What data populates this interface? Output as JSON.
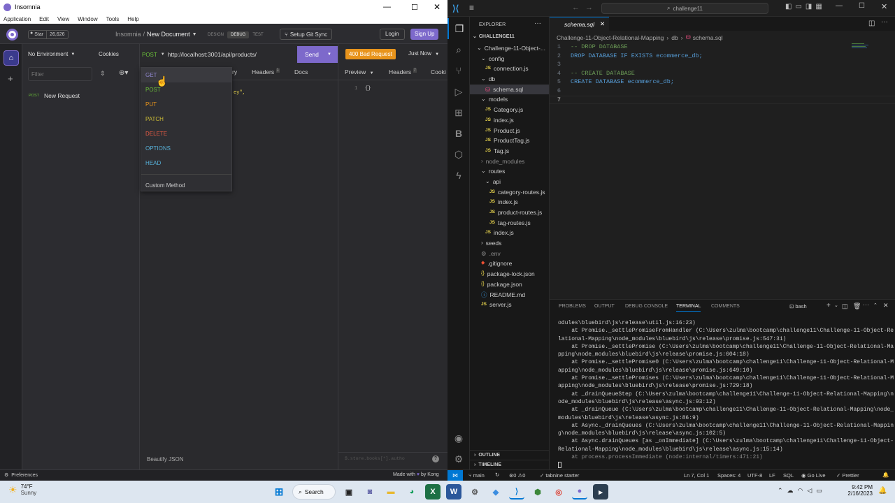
{
  "insomnia": {
    "window_title": "Insomnia",
    "menu": [
      "Application",
      "Edit",
      "View",
      "Window",
      "Tools",
      "Help"
    ],
    "github": {
      "star": "Star",
      "count": "26,626"
    },
    "breadcrumb": {
      "root": "Insomnia",
      "sep": "/",
      "doc": "New Document"
    },
    "modes": [
      "DESIGN",
      "DEBUG",
      "TEST"
    ],
    "git_sync": "Setup Git Sync",
    "login": "Login",
    "signup": "Sign Up",
    "environment": "No Environment",
    "cookies": "Cookies",
    "filter_placeholder": "Filter",
    "sidebar_request": {
      "method": "POST",
      "name": "New Request"
    },
    "url_bar": {
      "method": "POST",
      "url": "http://localhost:3001/api/products/",
      "send": "Send"
    },
    "status": {
      "badge": "400 Bad Request",
      "time": "Just Now"
    },
    "req_tabs": {
      "hidden": "ry",
      "headers": "Headers",
      "headers_count": "1",
      "docs": "Docs"
    },
    "resp_tabs": {
      "preview": "Preview",
      "headers": "Headers",
      "headers_count": "7",
      "cookies": "Cooki"
    },
    "body_fragment": "ey\",",
    "response": {
      "line": "1",
      "body": "{}"
    },
    "method_menu": [
      "GET",
      "POST",
      "PUT",
      "PATCH",
      "DELETE",
      "OPTIONS",
      "HEAD"
    ],
    "custom_method": "Custom Method",
    "beautify": "Beautify JSON",
    "filter_response": "$.store.books[*].autho",
    "footer": {
      "preferences": "Preferences",
      "made_with": "Made with",
      "by": "by Kong"
    }
  },
  "vscode": {
    "search": "challenge11",
    "explorer_title": "EXPLORER",
    "project": "CHALLENGE11",
    "tree": [
      {
        "label": "Challenge-11-Object-...",
        "kind": "folder",
        "depth": 1,
        "open": true
      },
      {
        "label": "config",
        "kind": "folder",
        "depth": 2,
        "open": true
      },
      {
        "label": "connection.js",
        "kind": "js",
        "depth": 3
      },
      {
        "label": "db",
        "kind": "folder",
        "depth": 2,
        "open": true
      },
      {
        "label": "schema.sql",
        "kind": "sql",
        "depth": 3,
        "selected": true
      },
      {
        "label": "models",
        "kind": "folder",
        "depth": 2,
        "open": true
      },
      {
        "label": "Category.js",
        "kind": "js",
        "depth": 3
      },
      {
        "label": "index.js",
        "kind": "js",
        "depth": 3
      },
      {
        "label": "Product.js",
        "kind": "js",
        "depth": 3
      },
      {
        "label": "ProductTag.js",
        "kind": "js",
        "depth": 3
      },
      {
        "label": "Tag.js",
        "kind": "js",
        "depth": 3
      },
      {
        "label": "node_modules",
        "kind": "folder",
        "depth": 2,
        "open": false,
        "dim": true
      },
      {
        "label": "routes",
        "kind": "folder",
        "depth": 2,
        "open": true
      },
      {
        "label": "api",
        "kind": "folder",
        "depth": 3,
        "open": true
      },
      {
        "label": "category-routes.js",
        "kind": "js",
        "depth": 4
      },
      {
        "label": "index.js",
        "kind": "js",
        "depth": 4
      },
      {
        "label": "product-routes.js",
        "kind": "js",
        "depth": 4
      },
      {
        "label": "tag-routes.js",
        "kind": "js",
        "depth": 4
      },
      {
        "label": "index.js",
        "kind": "js",
        "depth": 3
      },
      {
        "label": "seeds",
        "kind": "folder",
        "depth": 2,
        "open": false
      },
      {
        "label": ".env",
        "kind": "env",
        "depth": 2,
        "dim": true
      },
      {
        "label": ".gitignore",
        "kind": "git",
        "depth": 2
      },
      {
        "label": "package-lock.json",
        "kind": "json",
        "depth": 2
      },
      {
        "label": "package.json",
        "kind": "json",
        "depth": 2
      },
      {
        "label": "README.md",
        "kind": "md",
        "depth": 2
      },
      {
        "label": "server.js",
        "kind": "js",
        "depth": 2
      }
    ],
    "outline": "OUTLINE",
    "timeline": "TIMELINE",
    "tab": "schema.sql",
    "breadcrumbs": [
      "Challenge-11-Object-Relational-Mapping",
      "db",
      "schema.sql"
    ],
    "code": [
      {
        "n": "1",
        "text": "-- DROP DATABASE",
        "cls": "comment"
      },
      {
        "n": "2",
        "text": "DROP DATABASE IF EXISTS ecommerce_db;",
        "cls": "sql"
      },
      {
        "n": "3",
        "text": "",
        "cls": ""
      },
      {
        "n": "4",
        "text": "-- CREATE DATABASE",
        "cls": "comment"
      },
      {
        "n": "5",
        "text": "CREATE DATABASE ecommerce_db;",
        "cls": "sql"
      },
      {
        "n": "6",
        "text": "",
        "cls": ""
      },
      {
        "n": "7",
        "text": "",
        "cls": ""
      }
    ],
    "panel_tabs": [
      "PROBLEMS",
      "OUTPUT",
      "DEBUG CONSOLE",
      "TERMINAL",
      "COMMENTS"
    ],
    "shell": "bash",
    "terminal": [
      "odules\\bluebird\\js\\release\\util.js:16:23)",
      "    at Promise._settlePromiseFromHandler (C:\\Users\\zulma\\bootcamp\\challenge11\\Challenge-11-Object-Re",
      "lational-Mapping\\node_modules\\bluebird\\js\\release\\promise.js:547:31)",
      "    at Promise._settlePromise (C:\\Users\\zulma\\bootcamp\\challenge11\\Challenge-11-Object-Relational-Ma",
      "pping\\node_modules\\bluebird\\js\\release\\promise.js:604:18)",
      "    at Promise._settlePromise0 (C:\\Users\\zulma\\bootcamp\\challenge11\\Challenge-11-Object-Relational-M",
      "apping\\node_modules\\bluebird\\js\\release\\promise.js:649:10)",
      "    at Promise._settlePromises (C:\\Users\\zulma\\bootcamp\\challenge11\\Challenge-11-Object-Relational-M",
      "apping\\node_modules\\bluebird\\js\\release\\promise.js:729:18)",
      "    at _drainQueueStep (C:\\Users\\zulma\\bootcamp\\challenge11\\Challenge-11-Object-Relational-Mapping\\n",
      "ode_modules\\bluebird\\js\\release\\async.js:93:12)",
      "    at _drainQueue (C:\\Users\\zulma\\bootcamp\\challenge11\\Challenge-11-Object-Relational-Mapping\\node_",
      "modules\\bluebird\\js\\release\\async.js:86:9)",
      "    at Async._drainQueues (C:\\Users\\zulma\\bootcamp\\challenge11\\Challenge-11-Object-Relational-Mappin",
      "g\\node_modules\\bluebird\\js\\release\\async.js:102:5)",
      "    at Async.drainQueues [as _onImmediate] (C:\\Users\\zulma\\bootcamp\\challenge11\\Challenge-11-Object-",
      "Relational-Mapping\\node_modules\\bluebird\\js\\release\\async.js:15:14)",
      "    at process.processImmediate (node:internal/timers:471:21)"
    ],
    "status": {
      "branch": "main",
      "errors": "0",
      "warnings": "0",
      "tabnine": "tabnine starter",
      "position": "Ln 7, Col 1",
      "spaces": "Spaces: 4",
      "encoding": "UTF-8",
      "eol": "LF",
      "lang": "SQL",
      "golive": "Go Live",
      "prettier": "Prettier"
    }
  },
  "taskbar": {
    "temp": "74°F",
    "weather": "Sunny",
    "search": "Search",
    "time": "9:42 PM",
    "date": "2/16/2023"
  },
  "colors": {
    "insomnia_purple": "#7d69cb",
    "send": "#7d69cb",
    "bad_request": "#e8941c",
    "get": "#8e85cc",
    "post": "#6abf39",
    "put": "#e8941c",
    "patch": "#cdbd36",
    "delete": "#e45b44",
    "options": "#57b0d8",
    "head": "#57b0d8",
    "vscode_blue": "#0078d4"
  }
}
